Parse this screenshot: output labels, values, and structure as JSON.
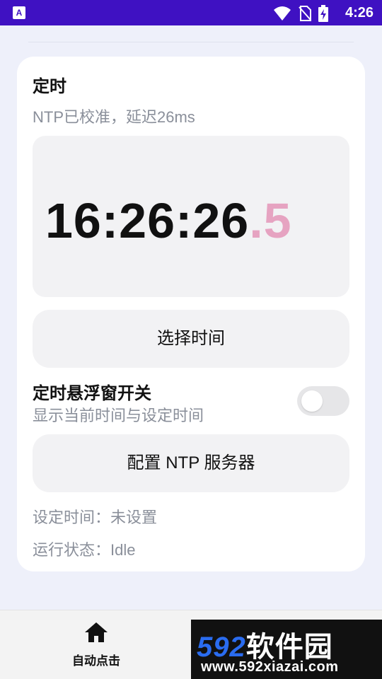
{
  "status_bar": {
    "time": "4:26",
    "app_icon_letter": "A",
    "icons": [
      "wifi-icon",
      "no-sim-icon",
      "battery-charging-icon"
    ],
    "background": "#3f11c2"
  },
  "timer_card": {
    "title": "定时",
    "subtitle": "NTP已校准，延迟26ms",
    "clock": {
      "main": "16:26:26",
      "fraction": ".5",
      "fraction_color": "#e6a3c1"
    },
    "select_time_button": "选择时间",
    "floating_toggle": {
      "title": "定时悬浮窗开关",
      "description": "显示当前时间与设定时间",
      "enabled": false
    },
    "ntp_button": "配置 NTP 服务器",
    "set_time_line": "设定时间：未设置",
    "status_line": "运行状态：Idle"
  },
  "bottom_nav": {
    "items": [
      {
        "label": "自动点击",
        "icon": "home-icon"
      }
    ]
  },
  "watermark": {
    "brand": "592软件园",
    "brand_number": "592",
    "brand_text": "软件园",
    "url": "www.592xiazai.com"
  }
}
